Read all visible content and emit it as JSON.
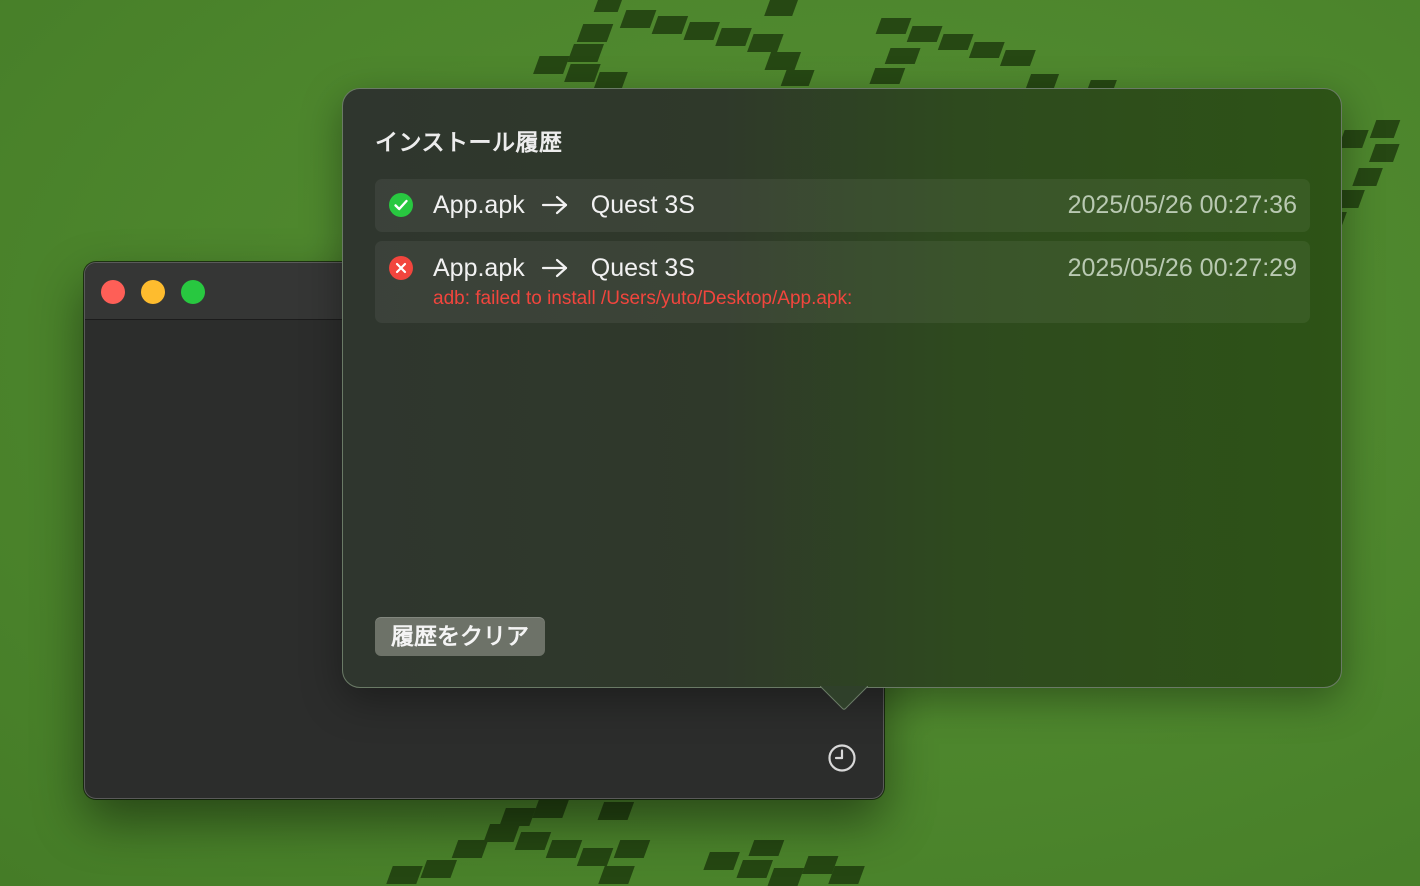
{
  "colors": {
    "wallpaper": "#4f8a2e",
    "success": "#28c840",
    "error": "#f2453d",
    "traffic_close": "#fe5f57",
    "traffic_min": "#febc2e",
    "traffic_max": "#28c840"
  },
  "popover": {
    "title": "インストール履歴",
    "items": [
      {
        "status": "success",
        "status_icon": "checkmark-circle-icon",
        "file": "App.apk",
        "arrow_icon": "arrow-right-icon",
        "device": "Quest 3S",
        "timestamp": "2025/05/26 00:27:36",
        "error": ""
      },
      {
        "status": "failed",
        "status_icon": "x-circle-icon",
        "file": "App.apk",
        "arrow_icon": "arrow-right-icon",
        "device": "Quest 3S",
        "timestamp": "2025/05/26 00:27:29",
        "error": "adb: failed to install /Users/yuto/Desktop/App.apk:"
      }
    ],
    "clear_button": "履歴をクリア"
  },
  "window": {
    "history_icon": "clock-icon"
  }
}
